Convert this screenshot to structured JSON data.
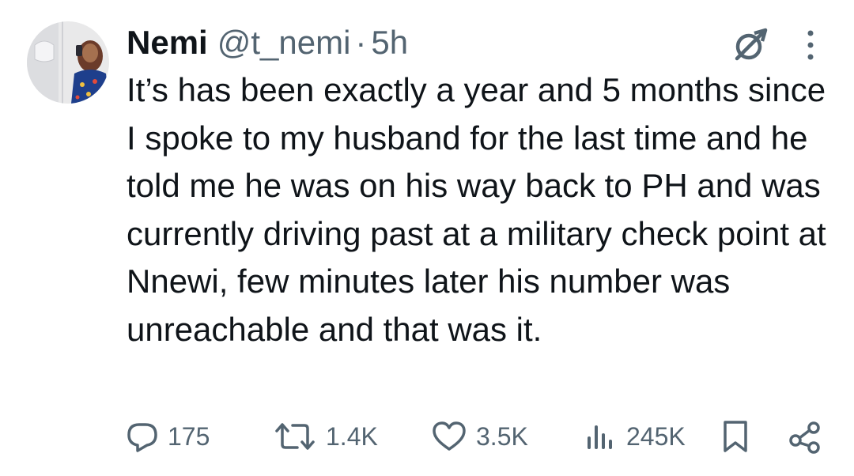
{
  "tweet": {
    "display_name": "Nemi",
    "handle": "@t_nemi",
    "separator": "·",
    "timestamp": "5h",
    "text": "It’s has been exactly a year and 5 months since I spoke to my husband for the last time and he told me he was on his way back to PH and was currently driving past at a military check point at Nnewi, few minutes later his number was unreachable and that was it."
  },
  "actions": {
    "replies": "175",
    "reposts": "1.4K",
    "likes": "3.5K",
    "views": "245K"
  },
  "icons": {
    "header": [
      "grok-icon",
      "more-options-icon"
    ],
    "actions": [
      "reply-icon",
      "repost-icon",
      "like-icon",
      "views-icon",
      "bookmark-icon",
      "share-icon"
    ]
  },
  "colors": {
    "text": "#0f1419",
    "secondary": "#536471",
    "background": "#ffffff"
  }
}
